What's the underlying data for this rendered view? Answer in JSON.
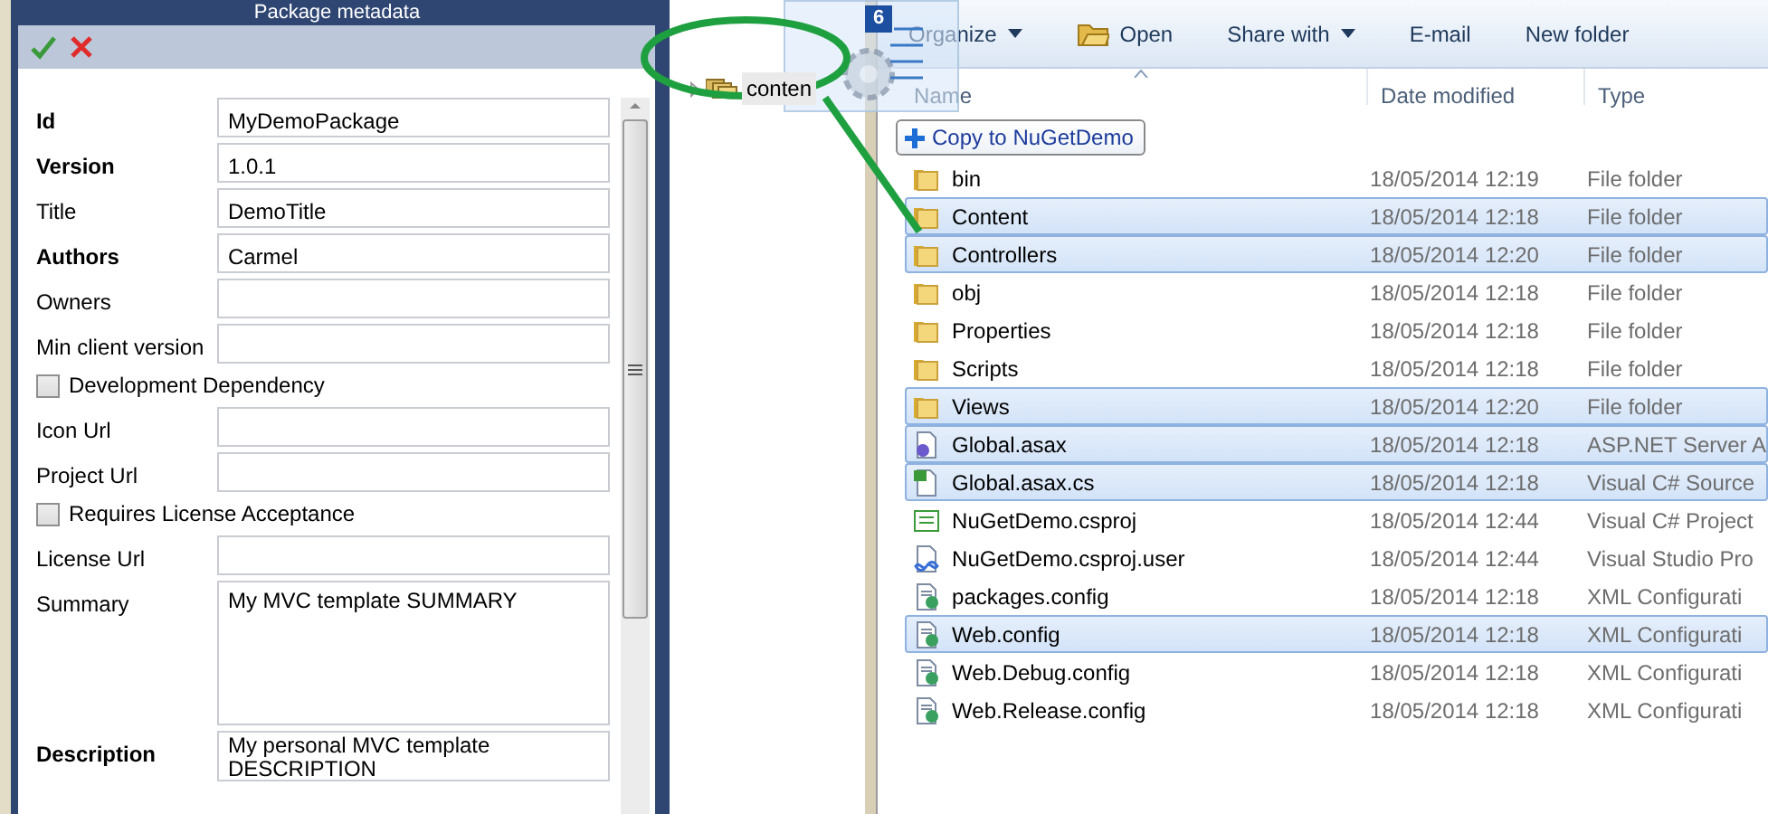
{
  "dialog": {
    "title": "Package metadata",
    "fields": [
      {
        "kind": "text",
        "label": "Id",
        "required": true,
        "value": "MyDemoPackage"
      },
      {
        "kind": "text",
        "label": "Version",
        "required": true,
        "value": "1.0.1"
      },
      {
        "kind": "text",
        "label": "Title",
        "required": false,
        "value": "DemoTitle"
      },
      {
        "kind": "text",
        "label": "Authors",
        "required": true,
        "value": "Carmel"
      },
      {
        "kind": "text",
        "label": "Owners",
        "required": false
      },
      {
        "kind": "text",
        "label": "Min client version",
        "required": false
      },
      {
        "kind": "checkbox",
        "label": "Development Dependency",
        "checked": false
      },
      {
        "kind": "text",
        "label": "Icon Url",
        "required": false
      },
      {
        "kind": "text",
        "label": "Project Url",
        "required": false
      },
      {
        "kind": "checkbox",
        "label": "Requires License Acceptance",
        "checked": false
      },
      {
        "kind": "text",
        "label": "License Url",
        "required": false
      },
      {
        "kind": "textarea",
        "label": "Summary",
        "required": false,
        "value": "My MVC template SUMMARY"
      },
      {
        "kind": "textarea",
        "label": "Description",
        "required": true,
        "value": "My personal MVC template DESCRIPTION"
      }
    ]
  },
  "tree": {
    "items": [
      {
        "label": "conten",
        "expanded": false
      }
    ]
  },
  "drag": {
    "count": "6",
    "tooltip": "Copy to NuGetDemo"
  },
  "explorer": {
    "toolbar": [
      {
        "kind": "menu",
        "label": "Organize"
      },
      {
        "kind": "open",
        "label": "Open"
      },
      {
        "kind": "menu",
        "label": "Share with"
      },
      {
        "kind": "plain",
        "label": "E-mail"
      },
      {
        "kind": "plain",
        "label": "New folder"
      }
    ],
    "columns": [
      "Name",
      "Date modified",
      "Type"
    ],
    "rows": [
      {
        "kind": "folder",
        "name": "bin",
        "date": "18/05/2014 12:19",
        "type": "File folder",
        "selected": false
      },
      {
        "kind": "folder",
        "name": "Content",
        "date": "18/05/2014 12:18",
        "type": "File folder",
        "selected": true
      },
      {
        "kind": "folder",
        "name": "Controllers",
        "date": "18/05/2014 12:20",
        "type": "File folder",
        "selected": true
      },
      {
        "kind": "folder",
        "name": "obj",
        "date": "18/05/2014 12:18",
        "type": "File folder",
        "selected": false
      },
      {
        "kind": "folder",
        "name": "Properties",
        "date": "18/05/2014 12:18",
        "type": "File folder",
        "selected": false
      },
      {
        "kind": "folder",
        "name": "Scripts",
        "date": "18/05/2014 12:18",
        "type": "File folder",
        "selected": false
      },
      {
        "kind": "folder",
        "name": "Views",
        "date": "18/05/2014 12:20",
        "type": "File folder",
        "selected": true
      },
      {
        "kind": "asax",
        "name": "Global.asax",
        "date": "18/05/2014 12:18",
        "type": "ASP.NET Server A",
        "selected": true
      },
      {
        "kind": "cs",
        "name": "Global.asax.cs",
        "date": "18/05/2014 12:18",
        "type": "Visual C# Source",
        "selected": true
      },
      {
        "kind": "csproj",
        "name": "NuGetDemo.csproj",
        "date": "18/05/2014 12:44",
        "type": "Visual C# Project",
        "selected": false
      },
      {
        "kind": "user",
        "name": "NuGetDemo.csproj.user",
        "date": "18/05/2014 12:44",
        "type": "Visual Studio Pro",
        "selected": false
      },
      {
        "kind": "config",
        "name": "packages.config",
        "date": "18/05/2014 12:18",
        "type": "XML Configurati",
        "selected": false
      },
      {
        "kind": "config",
        "name": "Web.config",
        "date": "18/05/2014 12:18",
        "type": "XML Configurati",
        "selected": true
      },
      {
        "kind": "config",
        "name": "Web.Debug.config",
        "date": "18/05/2014 12:18",
        "type": "XML Configurati",
        "selected": false
      },
      {
        "kind": "config",
        "name": "Web.Release.config",
        "date": "18/05/2014 12:18",
        "type": "XML Configurati",
        "selected": false
      }
    ]
  }
}
